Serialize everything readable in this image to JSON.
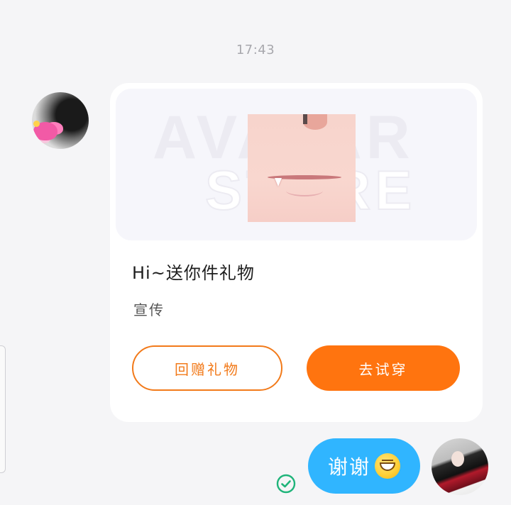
{
  "timestamp": "17:43",
  "card": {
    "watermark_top": "AVATAR",
    "watermark_bottom": "STORE",
    "title": "Hi~送你件礼物",
    "subtitle": "宣传",
    "buttons": {
      "return_gift": "回赠礼物",
      "try_on": "去试穿"
    }
  },
  "reply": {
    "text": "谢谢",
    "emoji": "grinning-face-emoji"
  },
  "colors": {
    "background": "#f5f5f7",
    "card": "#ffffff",
    "accent_orange": "#ff740f",
    "bubble_blue": "#30b5ff",
    "check_green": "#1fb47a"
  },
  "icons": {
    "sent_status": "check-circle-icon"
  }
}
